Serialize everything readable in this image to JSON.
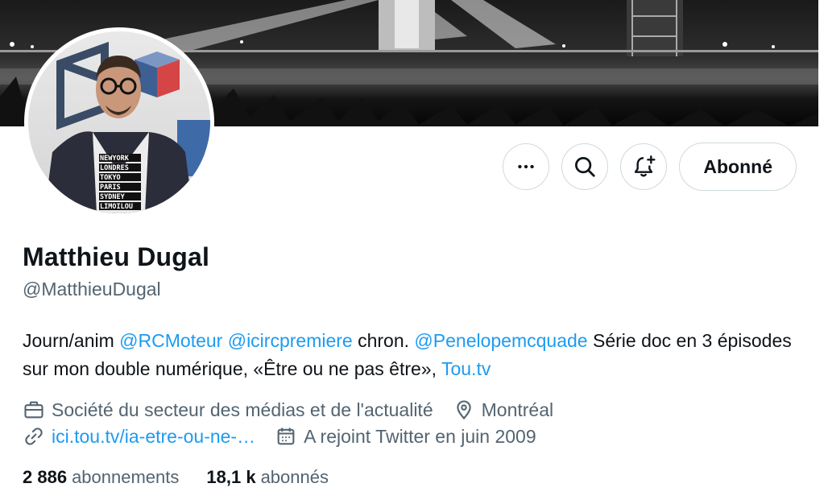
{
  "profile": {
    "name": "Matthieu Dugal",
    "handle": "@MatthieuDugal",
    "shirt_text": [
      "NEWYORK",
      "LONDRES",
      "TOKYO",
      "PARIS",
      "SYDNEY",
      "LIMOILOU"
    ]
  },
  "actions": {
    "more_icon": "more-horizontal-icon",
    "search_icon": "search-icon",
    "notify_icon": "bell-plus-icon",
    "follow_label": "Abonné"
  },
  "bio": {
    "t1": "Journ/anim ",
    "m1": "@RCMoteur",
    "t2": " ",
    "m2": "@icircpremiere",
    "t3": " chron. ",
    "m3": "@Penelopemcquade",
    "t4": " Série doc en 3 épisodes sur mon double numérique, «Être ou ne pas être», ",
    "l1": "Tou.tv"
  },
  "meta": {
    "category": "Société du secteur des médias et de l'actualité",
    "location": "Montréal",
    "website": "ici.tou.tv/ia-etre-ou-ne-…",
    "joined": "A rejoint Twitter en juin 2009"
  },
  "counts": {
    "following_value": "2 886",
    "following_label": "abonnements",
    "followers_value": "18,1 k",
    "followers_label": "abonnés"
  },
  "colors": {
    "link": "#1d9bf0",
    "secondary_text": "#536471",
    "border": "#cfd9de"
  }
}
